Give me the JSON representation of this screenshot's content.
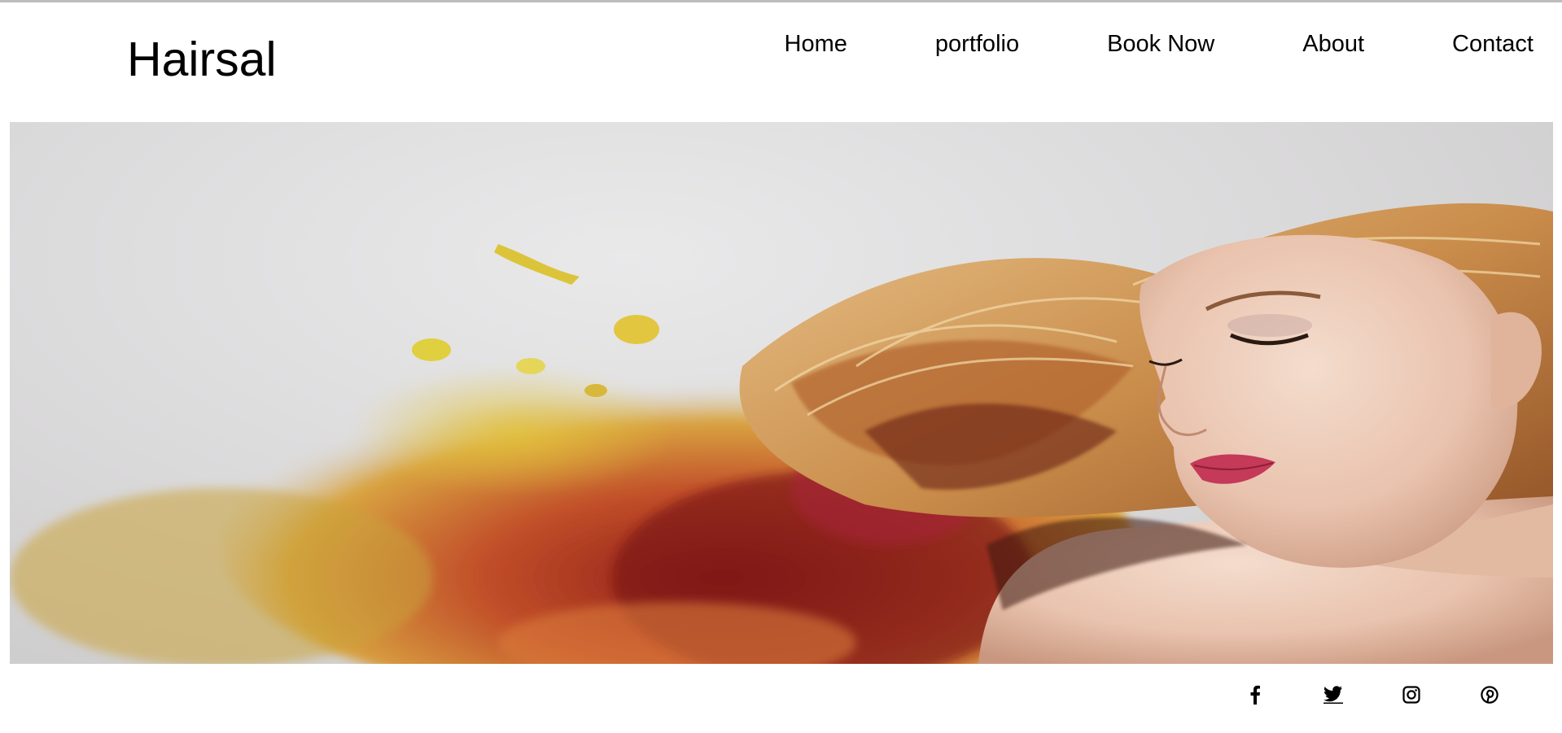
{
  "site": {
    "logo": "Hairsal"
  },
  "nav": {
    "items": [
      {
        "label": "Home"
      },
      {
        "label": "portfolio"
      },
      {
        "label": "Book Now"
      },
      {
        "label": "About"
      },
      {
        "label": "Contact"
      }
    ]
  },
  "hero": {
    "image": "woman-flowing-hair-illustration"
  },
  "social": {
    "icons": [
      "facebook-icon",
      "twitter-icon",
      "instagram-icon",
      "pinterest-icon"
    ]
  },
  "colors": {
    "text": "#000000",
    "background": "#ffffff",
    "top_rule": "#bdbdbd"
  }
}
